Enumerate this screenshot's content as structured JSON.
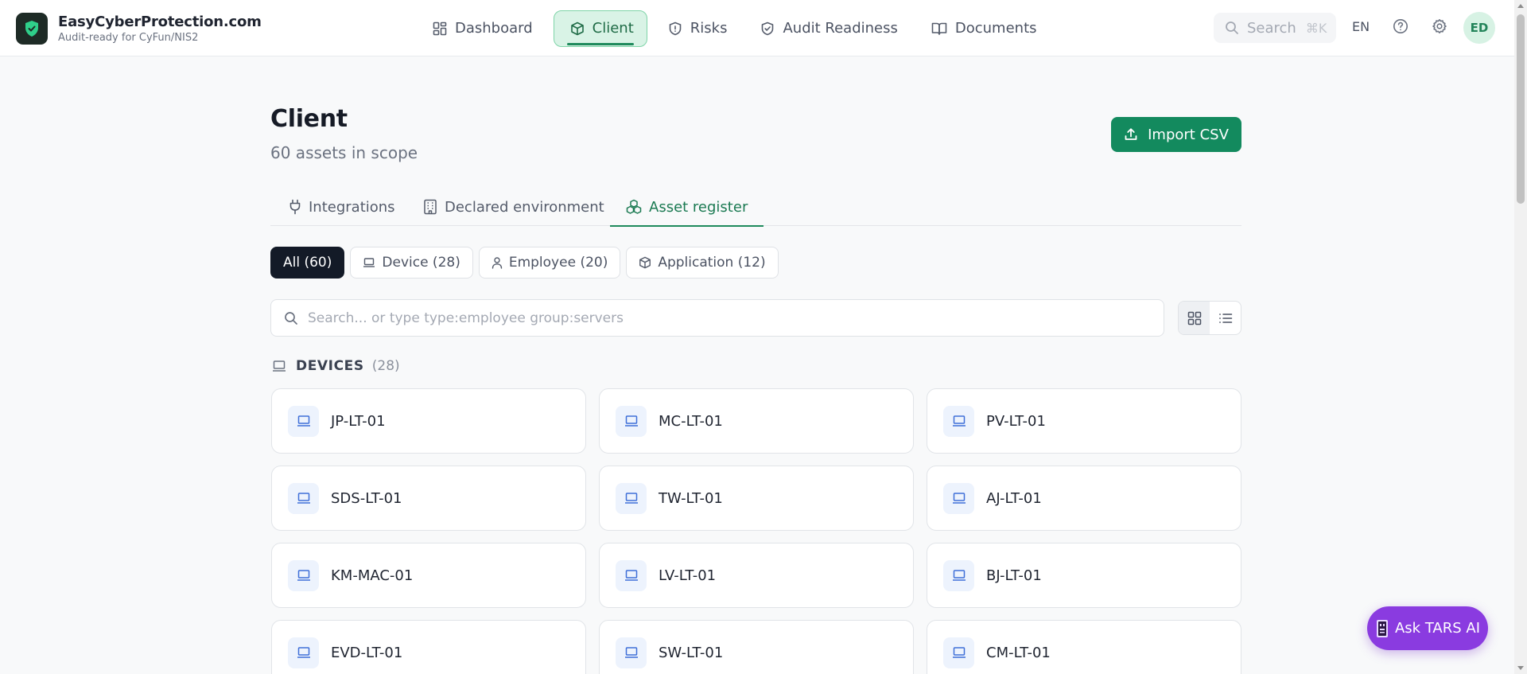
{
  "app": {
    "name": "EasyCyberProtection.com",
    "subtitle": "Audit-ready for CyFun/NIS2",
    "logo_icon": "shield-check-icon",
    "accent_color": "#138a5e"
  },
  "nav": {
    "items": [
      {
        "label": "Dashboard",
        "icon": "dashboard-icon"
      },
      {
        "label": "Client",
        "icon": "box-icon",
        "active": true
      },
      {
        "label": "Risks",
        "icon": "shield-alert-icon"
      },
      {
        "label": "Audit Readiness",
        "icon": "shield-check-icon"
      },
      {
        "label": "Documents",
        "icon": "book-icon"
      }
    ]
  },
  "topbar": {
    "search_label": "Search",
    "search_shortcut": "⌘K",
    "language": "EN",
    "avatar_initials": "ED"
  },
  "page": {
    "title": "Client",
    "subtitle": "60 assets in scope",
    "import_button": "Import CSV"
  },
  "tabs": [
    {
      "label": "Integrations",
      "icon": "plug-icon"
    },
    {
      "label": "Declared environment",
      "icon": "building-icon"
    },
    {
      "label": "Asset register",
      "icon": "boxes-icon",
      "active": true
    }
  ],
  "filters": [
    {
      "label": "All (60)",
      "active": true
    },
    {
      "label": "Device (28)",
      "icon": "laptop-icon"
    },
    {
      "label": "Employee (20)",
      "icon": "user-icon"
    },
    {
      "label": "Application (12)",
      "icon": "box-icon"
    }
  ],
  "search": {
    "placeholder": "Search... or type type:employee group:servers"
  },
  "view_toggle": {
    "selected": "grid"
  },
  "devices": {
    "title": "DEVICES",
    "count": "(28)",
    "items": [
      "JP-LT-01",
      "MC-LT-01",
      "PV-LT-01",
      "SDS-LT-01",
      "TW-LT-01",
      "AJ-LT-01",
      "KM-MAC-01",
      "LV-LT-01",
      "BJ-LT-01",
      "EVD-LT-01",
      "SW-LT-01",
      "CM-LT-01"
    ]
  },
  "assistant": {
    "label": "Ask TARS AI",
    "color": "#8a3be0"
  }
}
